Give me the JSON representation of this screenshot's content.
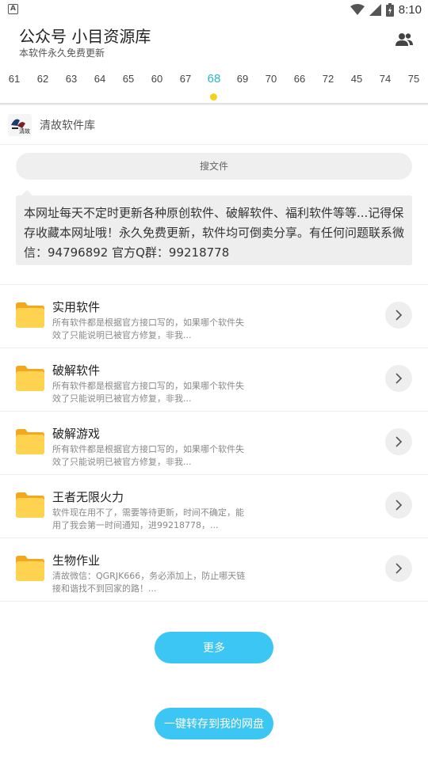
{
  "status_bar": {
    "notification_icon": "A",
    "icons": [
      "wifi-icon",
      "signal-icon",
      "battery-icon"
    ],
    "time": "8:10"
  },
  "header": {
    "title": "公众号 小目资源库",
    "subtitle": "本软件永久免费更新",
    "action_icon": "people-icon"
  },
  "tabs": {
    "items": [
      "61",
      "62",
      "63",
      "64",
      "65",
      "60",
      "67",
      "68",
      "69",
      "70",
      "66",
      "72",
      "45",
      "74",
      "75"
    ],
    "active": "68",
    "active_color": "#2ab5c9",
    "indicator_color": "#f4d21a"
  },
  "site": {
    "name": "清故软件库",
    "logo_text": "清故"
  },
  "search": {
    "placeholder": "搜文件"
  },
  "notice": {
    "text": "本网址每天不定时更新各种原创软件、破解软件、福利软件等等...记得保存收藏本网址哦！永久免费更新，软件均可倒卖分享。有任何问题联系微信：94796892 官方Q群：99218778"
  },
  "folders": [
    {
      "title": "实用软件",
      "desc": "所有软件都是根据官方接口写的，如果哪个软件失效了只能说明已被官方修复，非我..."
    },
    {
      "title": "破解软件",
      "desc": "所有软件都是根据官方接口写的，如果哪个软件失效了只能说明已被官方修复，非我..."
    },
    {
      "title": "破解游戏",
      "desc": "所有软件都是根据官方接口写的，如果哪个软件失效了只能说明已被官方修复，非我..."
    },
    {
      "title": "王者无限火力",
      "desc": "软件现在用不了，需要等待更新，时间不确定，能用了我会第一时间通知，进99218778，..."
    },
    {
      "title": "生物作业",
      "desc": "清故微信：QGRJK666，务必添加上，防止哪天链接和谐找不到回家的路！..."
    }
  ],
  "buttons": {
    "more": "更多",
    "save_to_drive": "一键转存到我的网盘",
    "accent_color": "#3cc6f4"
  }
}
